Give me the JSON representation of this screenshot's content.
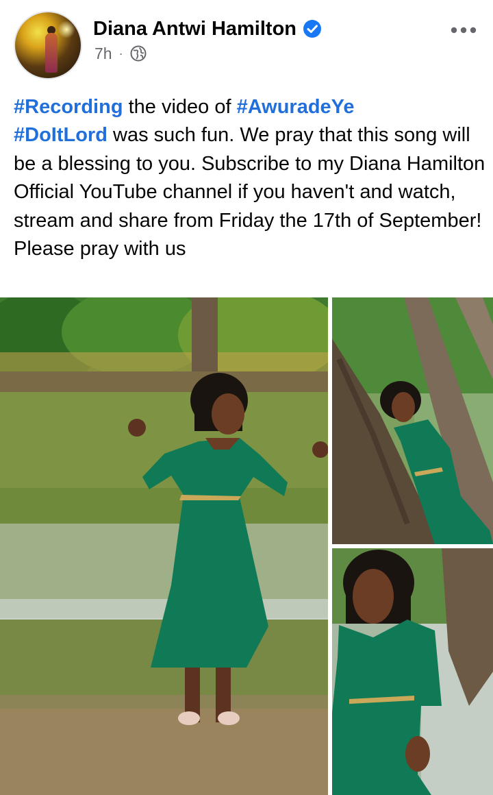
{
  "post": {
    "author": "Diana Antwi Hamilton",
    "time": "7h",
    "separator": "·",
    "verified_icon": "verified-badge-icon",
    "audience_icon": "globe-icon",
    "menu_icon": "more-options-icon",
    "text": {
      "tag_recording": "#Recording",
      "part1": " the video of ",
      "tag_awuradeye": "#AwuradeYe",
      "tag_doitlord": "#DoItLord",
      "part2": " was such fun. We pray that this song will be a blessing to you. Subscribe to my Diana Hamilton Official YouTube channel if you haven't and watch, stream and share from Friday the 17th of September! Please pray with us"
    },
    "photos": [
      {
        "icon": "photo-singer-by-lake"
      },
      {
        "icon": "photo-singer-by-tree"
      },
      {
        "icon": "photo-singer-closeup"
      }
    ]
  },
  "colors": {
    "hashtag": "#216fdb",
    "verified": "#1877f2",
    "meta": "#65676b",
    "dress": "#0f7a55"
  }
}
